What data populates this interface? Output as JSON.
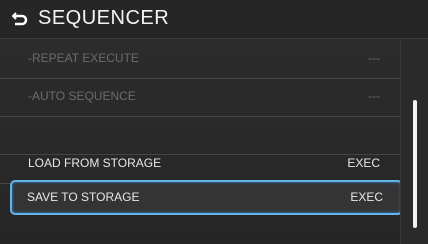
{
  "header": {
    "title": "SEQUENCER",
    "back_icon": "return-arrow-icon"
  },
  "list": {
    "items": [
      {
        "label": "-REPEAT EXECUTE",
        "value": "---",
        "state": "disabled"
      },
      {
        "label": "-AUTO SEQUENCE",
        "value": "---",
        "state": "disabled"
      },
      {
        "label": "",
        "value": "",
        "state": "empty"
      },
      {
        "label": "LOAD FROM STORAGE",
        "value": "EXEC",
        "state": "normal"
      },
      {
        "label": "SAVE TO STORAGE",
        "value": "EXEC",
        "state": "selected"
      }
    ]
  },
  "colors": {
    "selection": "#63b4e8",
    "text": "#e8e8e8",
    "disabled_text": "#6b6b6b"
  }
}
